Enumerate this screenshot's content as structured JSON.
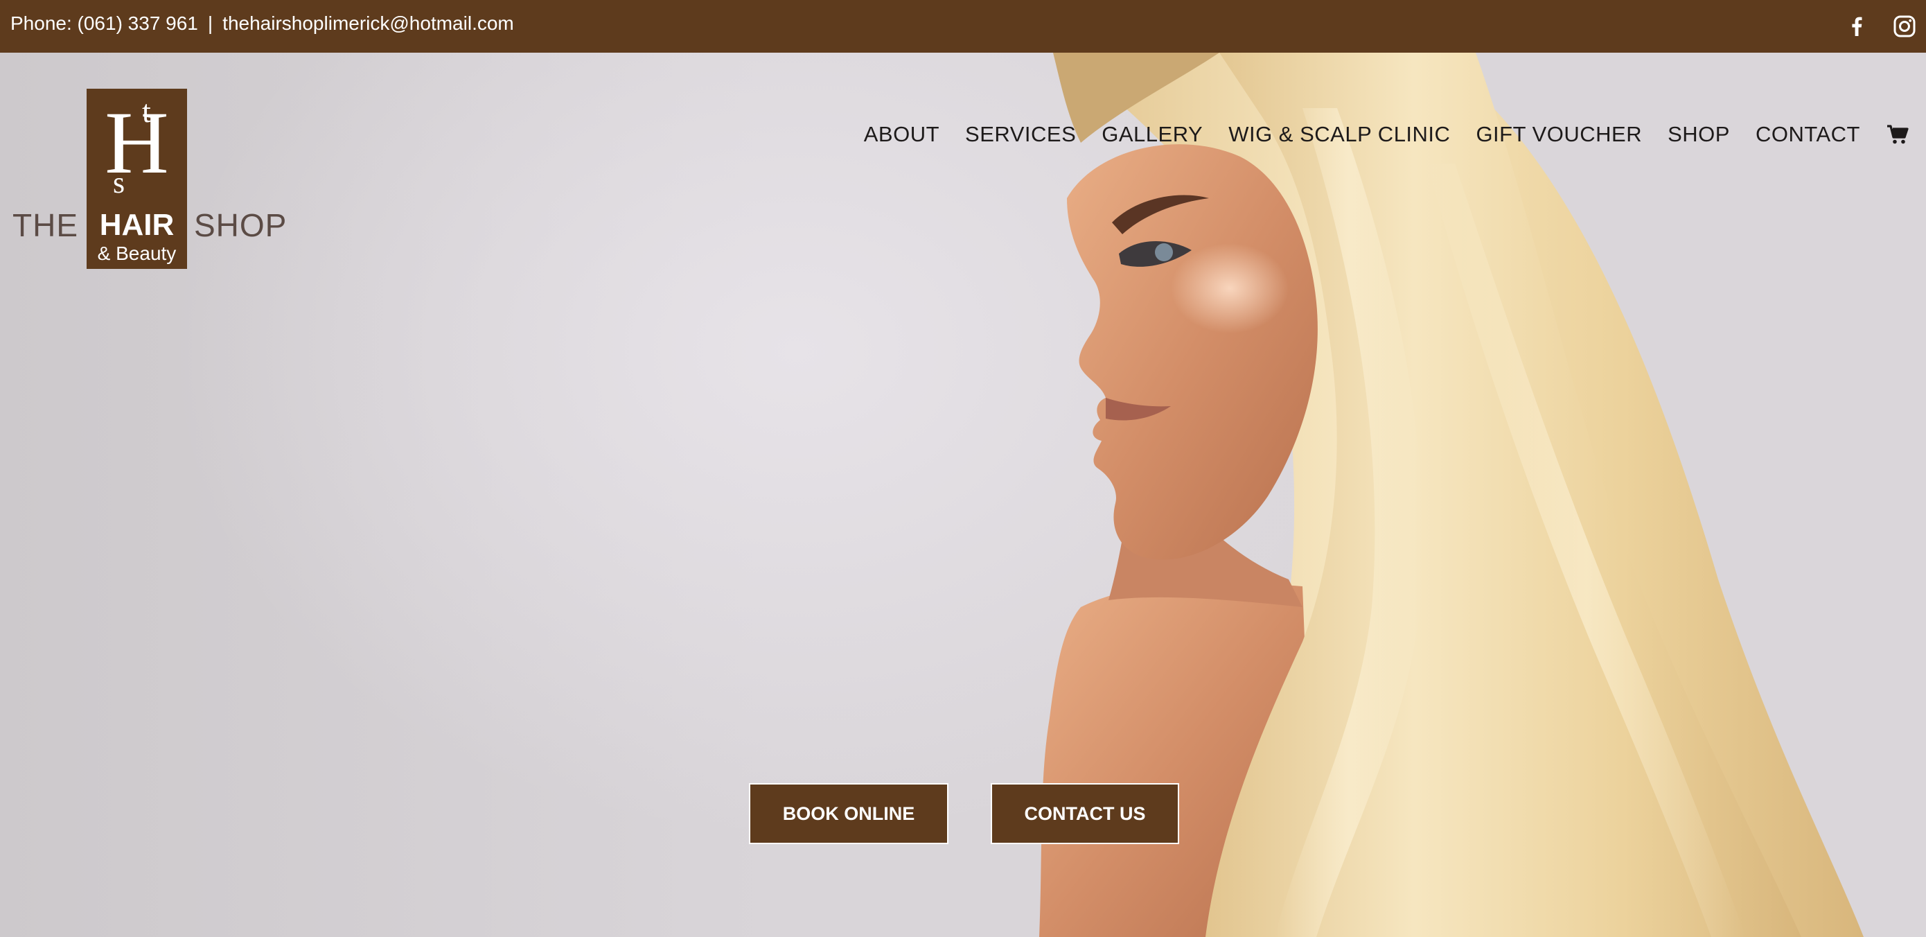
{
  "colors": {
    "brand": "#5e3b1d",
    "topbar_text": "#ffffff",
    "nav_text": "#1d1a1a",
    "hero_background": "#d5d2d5"
  },
  "topbar": {
    "phone": "Phone: (061) 337 961",
    "separator": "|",
    "email": "thehairshoplimerick@hotmail.com",
    "social_icons": [
      "facebook-icon",
      "instagram-icon"
    ]
  },
  "logo": {
    "monogram_h": "H",
    "monogram_t": "t",
    "monogram_s": "s",
    "the": "THE",
    "hair": "HAIR",
    "shop": "SHOP",
    "beauty": "& Beauty"
  },
  "nav": {
    "items": [
      {
        "label": "ABOUT"
      },
      {
        "label": "SERVICES"
      },
      {
        "label": "GALLERY"
      },
      {
        "label": "WIG & SCALP CLINIC"
      },
      {
        "label": "GIFT VOUCHER"
      },
      {
        "label": "SHOP"
      },
      {
        "label": "CONTACT"
      }
    ],
    "cart_icon": "cart-icon"
  },
  "hero": {
    "image": "woman-with-long-blonde-hair-profile",
    "buttons": {
      "book": "BOOK ONLINE",
      "contact": "CONTACT US"
    }
  }
}
